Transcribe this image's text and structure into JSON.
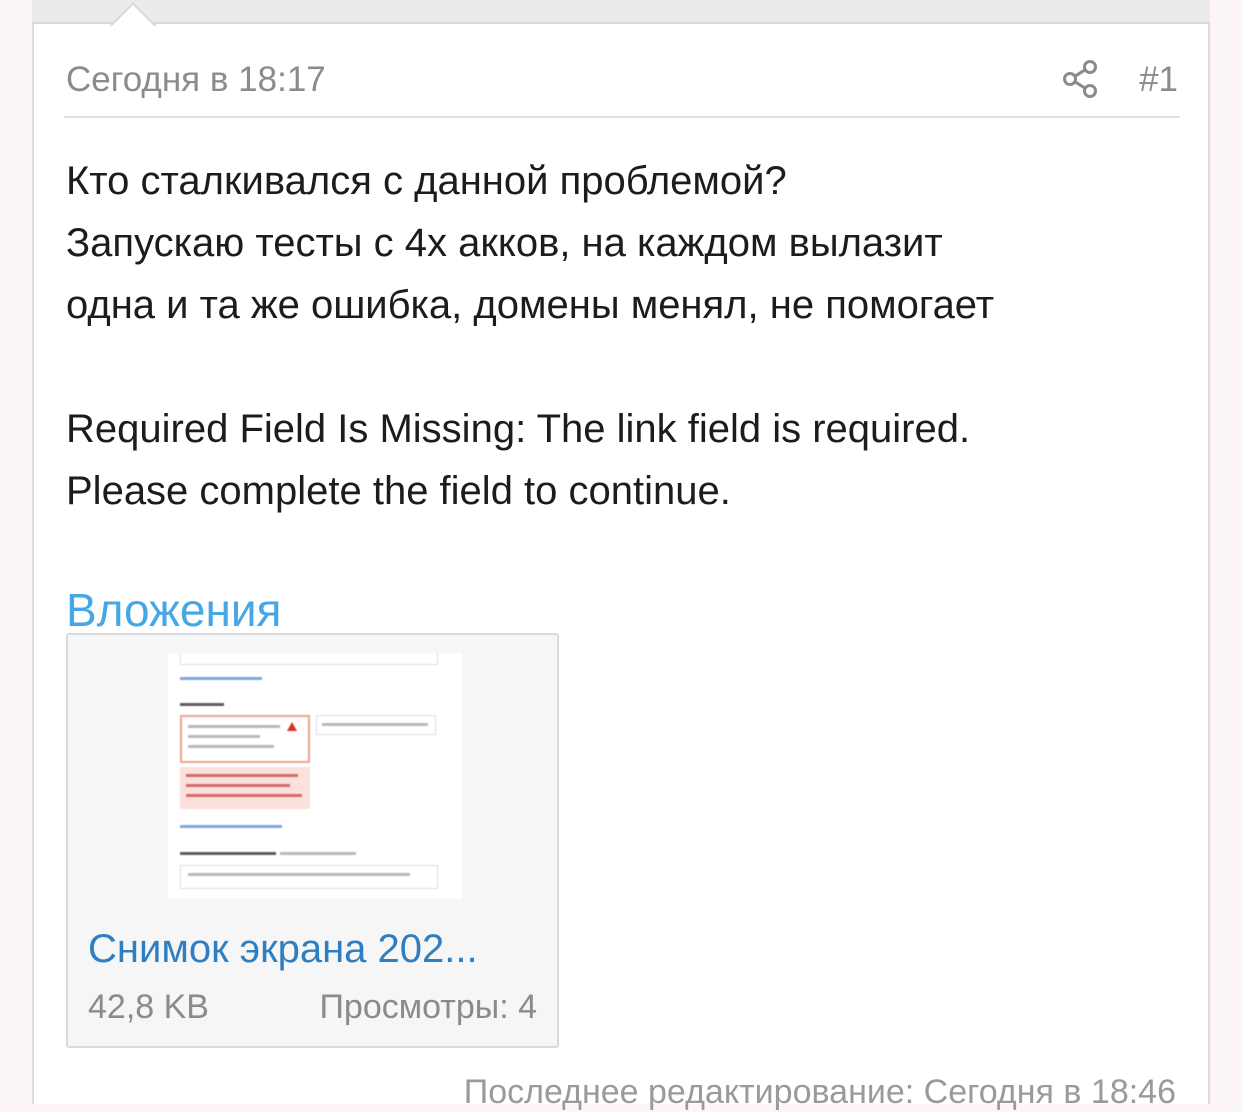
{
  "post": {
    "date": "Сегодня в 18:17",
    "number": "#1",
    "share_icon": "share-icon",
    "body_lines": [
      "Кто сталкивался с данной проблемой?",
      "Запускаю тесты с 4х акков, на каждом вылазит",
      "одна и та же ошибка, домены менял, не помогает"
    ],
    "error_lines": [
      "Required Field Is Missing: The link field is required.",
      "Please complete the field to continue."
    ],
    "last_edit": "Последнее редактирование: Сегодня в 18:46"
  },
  "attachments": {
    "heading": "Вложения",
    "items": [
      {
        "name": "Снимок экрана 202...",
        "size": "42,8 KB",
        "views": "Просмотры: 4"
      }
    ]
  },
  "colors": {
    "accent": "#47a7e6",
    "link": "#2f7ec2",
    "muted": "#8b8b8b",
    "text": "#1c1c1c"
  }
}
